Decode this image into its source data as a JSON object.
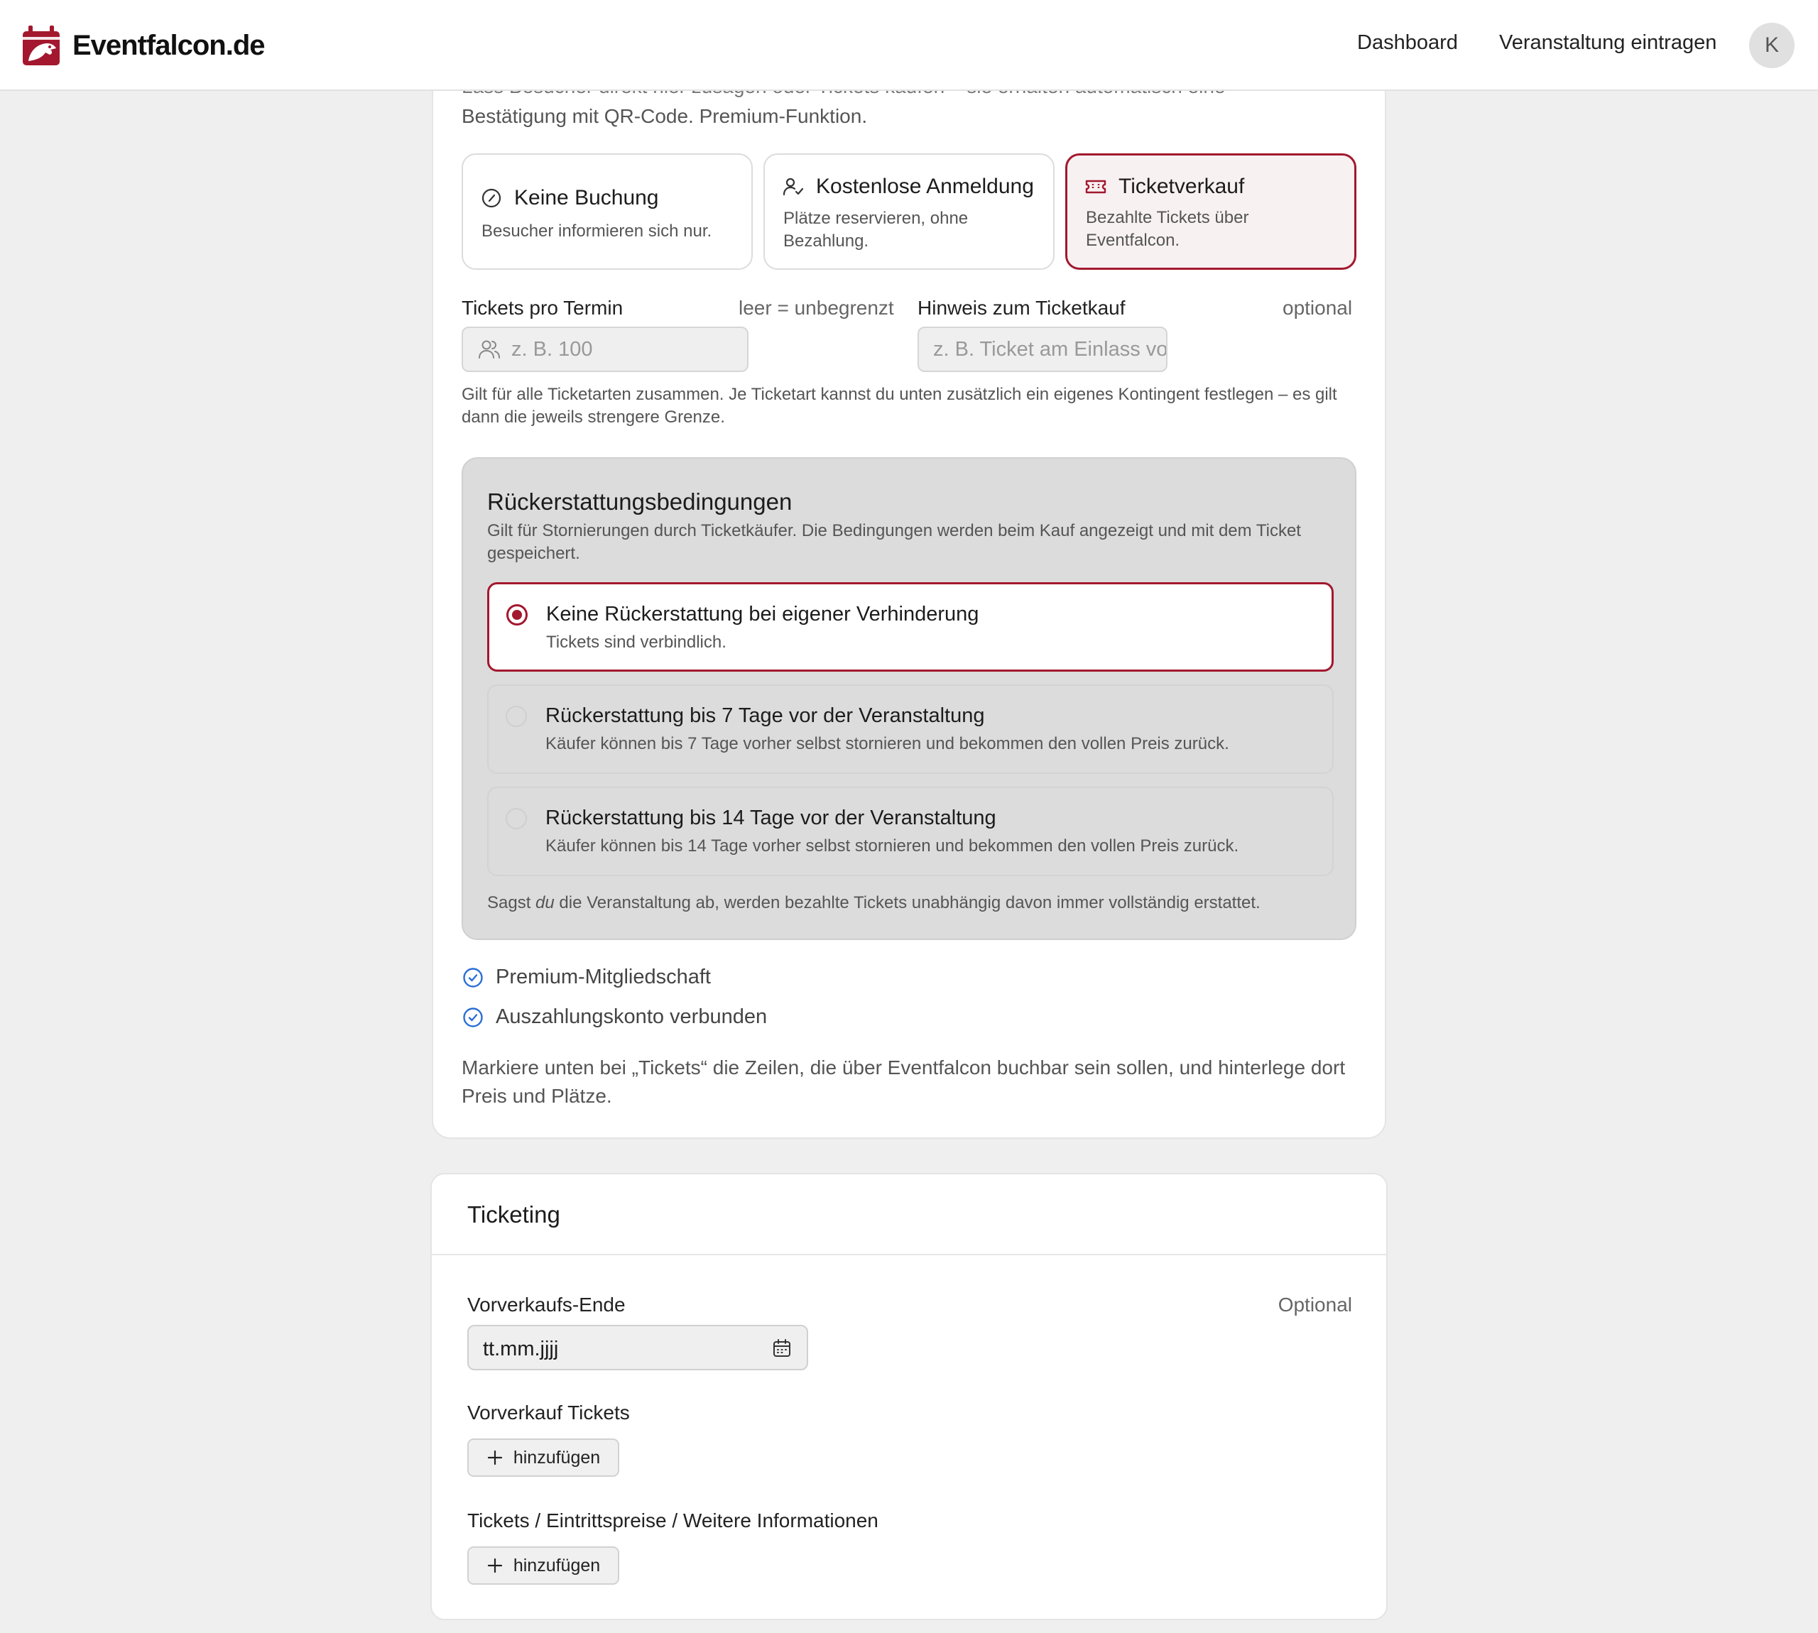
{
  "header": {
    "brand": "Eventfalcon.de",
    "nav": {
      "dashboard": "Dashboard",
      "create_event": "Veranstaltung eintragen"
    },
    "avatar_initial": "K"
  },
  "booking": {
    "intro_cut": "Lass Besucher direkt hier zusagen oder Tickets kaufen – sie erhalten automatisch eine",
    "intro_line2": "Bestätigung mit QR-Code. Premium-Funktion.",
    "options": [
      {
        "icon": "circle-slash-icon",
        "title": "Keine Buchung",
        "desc": "Besucher informieren sich nur.",
        "selected": false
      },
      {
        "icon": "user-check-icon",
        "title": "Kostenlose Anmeldung",
        "desc": "Plätze reservieren, ohne Bezahlung.",
        "selected": false
      },
      {
        "icon": "ticket-icon",
        "title": "Ticketverkauf",
        "desc": "Bezahlte Tickets über Eventfalcon.",
        "selected": true
      }
    ],
    "tickets_per_date": {
      "label": "Tickets pro Termin",
      "hint": "leer = unbegrenzt",
      "placeholder": "z. B. 100"
    },
    "ticket_note": {
      "label": "Hinweis zum Ticketkauf",
      "hint": "optional",
      "placeholder": "z. B. Ticket am Einlass vorzeigen"
    },
    "contingent_note": "Gilt für alle Ticketarten zusammen. Je Ticketart kannst du unten zusätzlich ein eigenes Kontingent festlegen – es gilt dann die jeweils strengere Grenze."
  },
  "refund": {
    "title": "Rückerstattungsbedingungen",
    "desc": "Gilt für Stornierungen durch Ticketkäufer. Die Bedingungen werden beim Kauf angezeigt und mit dem Ticket gespeichert.",
    "options": [
      {
        "title": "Keine Rückerstattung bei eigener Verhinderung",
        "desc": "Tickets sind verbindlich.",
        "selected": true
      },
      {
        "title": "Rückerstattung bis 7 Tage vor der Veranstaltung",
        "desc": "Käufer können bis 7 Tage vorher selbst stornieren und bekommen den vollen Preis zurück.",
        "selected": false
      },
      {
        "title": "Rückerstattung bis 14 Tage vor der Veranstaltung",
        "desc": "Käufer können bis 14 Tage vorher selbst stornieren und bekommen den vollen Preis zurück.",
        "selected": false
      }
    ],
    "footer_pre": "Sagst ",
    "footer_em": "du",
    "footer_post": " die Veranstaltung ab, werden bezahlte Tickets unabhängig davon immer vollständig erstattet."
  },
  "requirements": [
    "Premium-Mitgliedschaft",
    "Auszahlungskonto verbunden"
  ],
  "instructions": "Markiere unten bei „Tickets“ die Zeilen, die über Eventfalcon buchbar sein sollen, und hinterlege dort Preis und Plätze.",
  "ticketing": {
    "title": "Ticketing",
    "presale_end": {
      "label": "Vorverkaufs-Ende",
      "optional": "Optional",
      "value": "tt.mm.jjjj"
    },
    "presale_tickets": {
      "label": "Vorverkauf Tickets",
      "button": "hinzufügen"
    },
    "tickets_info": {
      "label": "Tickets / Eintrittspreise / Weitere Informationen",
      "button": "hinzufügen"
    }
  },
  "colors": {
    "accent": "#a3182e",
    "check": "#2b6fd6",
    "background": "#efefef"
  }
}
